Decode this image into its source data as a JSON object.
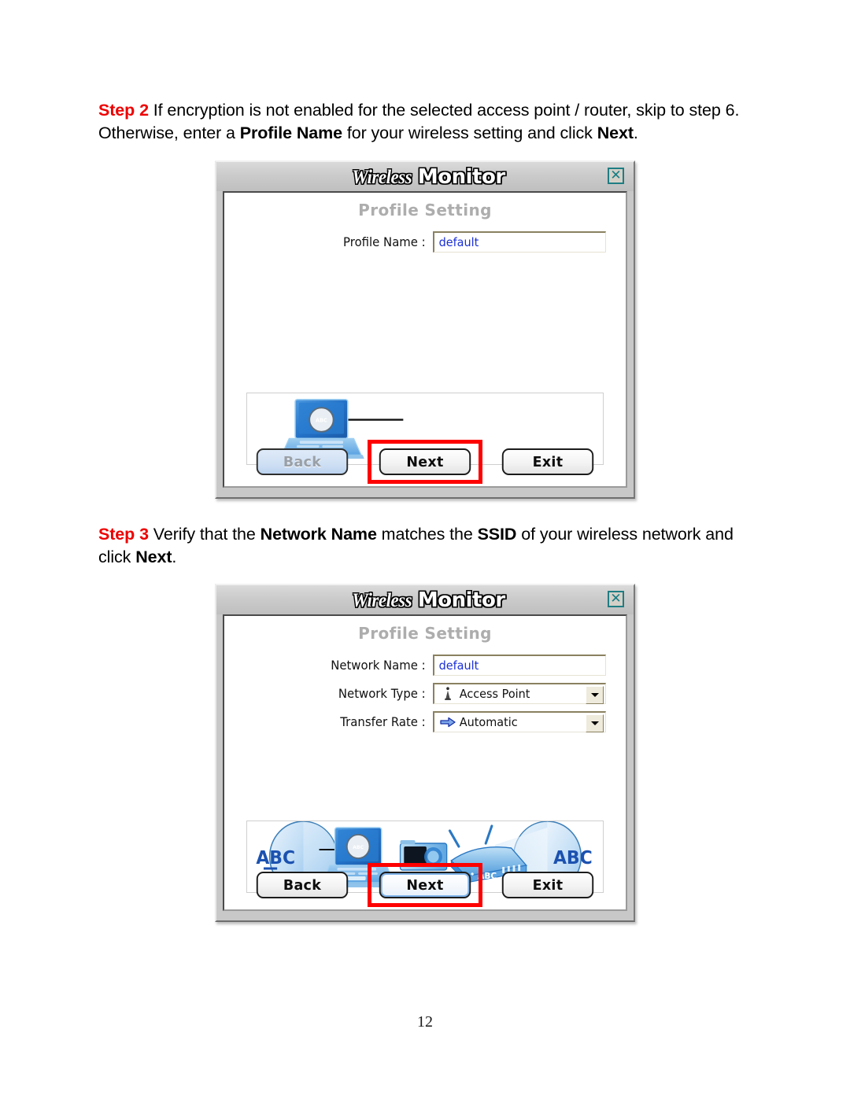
{
  "document": {
    "page_number": "12"
  },
  "steps": [
    {
      "tag": "Step 2",
      "line1_a": " If encryption is not enabled for the selected access point / router, skip to step 6.",
      "line2_a": "Otherwise, enter a ",
      "line2_b": "Profile Name",
      "line2_c": " for your wireless setting and click ",
      "line2_d": "Next",
      "line2_e": "."
    },
    {
      "tag": "Step 3",
      "line1_a": " Verify that the ",
      "line1_b": "Network Name",
      "line1_c": " matches the ",
      "line1_d": "SSID",
      "line1_e": " of your wireless network and",
      "line2_a": "click ",
      "line2_b": "Next",
      "line2_c": "."
    }
  ],
  "dialog1": {
    "title_part1": "Wireless",
    "title_part2": "Monitor",
    "close_label": "✕",
    "panel_heading": "Profile Setting",
    "fields": [
      {
        "label": "Profile Name :",
        "value": "default",
        "type": "text"
      }
    ],
    "artwork": {
      "description": "laptop-with-magnifier",
      "laptop_label": "ABC"
    },
    "buttons": [
      {
        "label": "Back",
        "state": "disabled",
        "highlighted": false
      },
      {
        "label": "Next",
        "state": "normal",
        "highlighted": true
      },
      {
        "label": "Exit",
        "state": "normal",
        "highlighted": false
      }
    ]
  },
  "dialog2": {
    "title_part1": "Wireless",
    "title_part2": "Monitor",
    "close_label": "✕",
    "panel_heading": "Profile Setting",
    "fields": [
      {
        "label": "Network Name :",
        "value": "default",
        "type": "text",
        "icon": ""
      },
      {
        "label": "Network Type :",
        "value": "Access Point",
        "type": "combo",
        "icon": "antenna-tower-icon"
      },
      {
        "label": "Transfer Rate :",
        "value": "Automatic",
        "type": "combo",
        "icon": "blue-arrow-icon"
      }
    ],
    "artwork": {
      "description": "laptop-camera-router-network",
      "left_label": "ABC",
      "right_label": "ABC",
      "router_label": "ABC",
      "laptop_label": "ABC"
    },
    "buttons": [
      {
        "label": "Back",
        "state": "normal",
        "highlighted": false
      },
      {
        "label": "Next",
        "state": "focused",
        "highlighted": true
      },
      {
        "label": "Exit",
        "state": "normal",
        "highlighted": false
      }
    ]
  },
  "colors": {
    "step_tag": "#ee0000",
    "highlight_box": "#fe0000",
    "input_text": "#1a2fd6",
    "panel_heading": "#adadad",
    "close_icon": "#157d84",
    "artwork_blue": "#2d7fd4"
  }
}
